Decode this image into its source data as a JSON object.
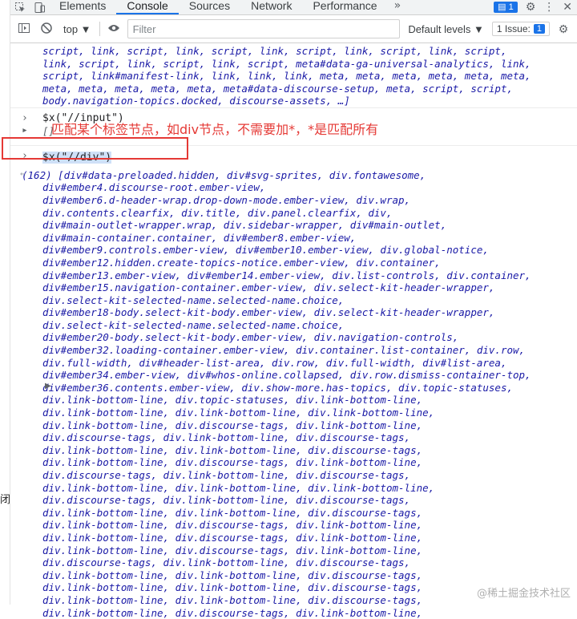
{
  "tabs": {
    "inspect_icon": "cursor-select-icon",
    "device_icon": "device-toolbar-icon",
    "items": [
      {
        "label": "Elements",
        "active": false
      },
      {
        "label": "Console",
        "active": true
      },
      {
        "label": "Sources",
        "active": false
      },
      {
        "label": "Network",
        "active": false
      },
      {
        "label": "Performance",
        "active": false
      }
    ],
    "more_label": "»",
    "issues_badge_count": "1",
    "settings_icon": "gear-icon",
    "kebab_icon": "more-vert-icon",
    "close_icon": "close-icon"
  },
  "toolbar": {
    "sidebar_icon": "sidebar-toggle-icon",
    "clear_icon": "block-icon",
    "context_value": "top ▼",
    "eye_icon": "eye-icon",
    "filter_placeholder": "Filter",
    "levels_label": "Default levels ▼",
    "issue_label": "1 Issue:",
    "issue_count": "1",
    "settings_icon": "gear-icon"
  },
  "console": {
    "top_lines": [
      "script, link, script, link, script, link, script, link, script, link, script,",
      "link, script, link, script, link, script, meta#data-ga-universal-analytics, link,",
      "script, link#manifest-link, link, link, link, meta, meta, meta, meta, meta, meta,",
      "meta, meta, meta, meta, meta, meta#data-discourse-setup, meta, script, script,",
      "body.navigation-topics.docked, discourse-assets, …]"
    ],
    "cmd1": "$x(\"//input\")",
    "result1": "[]",
    "cmd2": "$x(\"//div\")",
    "result2_lines": [
      "(162) [div#data-preloaded.hidden, div#svg-sprites, div.fontawesome,",
      "div#ember4.discourse-root.ember-view,",
      "div#ember6.d-header-wrap.drop-down-mode.ember-view, div.wrap,",
      "div.contents.clearfix, div.title, div.panel.clearfix, div,",
      "div#main-outlet-wrapper.wrap, div.sidebar-wrapper, div#main-outlet,",
      "div#main-container.container, div#ember8.ember-view,",
      "div#ember9.controls.ember-view, div#ember10.ember-view, div.global-notice,",
      "div#ember12.hidden.create-topics-notice.ember-view, div.container,",
      "div#ember13.ember-view, div#ember14.ember-view, div.list-controls, div.container,",
      "div#ember15.navigation-container.ember-view, div.select-kit-header-wrapper,",
      "div.select-kit-selected-name.selected-name.choice,",
      "div#ember18-body.select-kit-body.ember-view, div.select-kit-header-wrapper,",
      "div.select-kit-selected-name.selected-name.choice,",
      "div#ember20-body.select-kit-body.ember-view, div.navigation-controls,",
      "div#ember32.loading-container.ember-view, div.container.list-container, div.row,",
      "div.full-width, div#header-list-area, div.row, div.full-width, div#list-area,",
      "div#ember34.ember-view, div#whos-online.collapsed, div.row.dismiss-container-top,",
      "div#ember36.contents.ember-view, div.show-more.has-topics, div.topic-statuses,",
      "div.link-bottom-line, div.topic-statuses, div.link-bottom-line,",
      "div.link-bottom-line, div.link-bottom-line, div.link-bottom-line,",
      "div.link-bottom-line, div.discourse-tags, div.link-bottom-line,",
      "div.discourse-tags, div.link-bottom-line, div.discourse-tags,",
      "div.link-bottom-line, div.link-bottom-line, div.discourse-tags,",
      "div.link-bottom-line, div.discourse-tags, div.link-bottom-line,",
      "div.discourse-tags, div.link-bottom-line, div.discourse-tags,",
      "div.link-bottom-line, div.link-bottom-line, div.link-bottom-line,",
      "div.discourse-tags, div.link-bottom-line, div.discourse-tags,",
      "div.link-bottom-line, div.link-bottom-line, div.discourse-tags,",
      "div.link-bottom-line, div.discourse-tags, div.link-bottom-line,",
      "div.link-bottom-line, div.discourse-tags, div.link-bottom-line,",
      "div.link-bottom-line, div.discourse-tags, div.link-bottom-line,",
      "div.discourse-tags, div.link-bottom-line, div.discourse-tags,",
      "div.link-bottom-line, div.link-bottom-line, div.discourse-tags,",
      "div.link-bottom-line, div.link-bottom-line, div.discourse-tags,",
      "div.link-bottom-line, div.link-bottom-line, div.discourse-tags,",
      "div.link-bottom-line, div.discourse-tags, div.link-bottom-line,"
    ]
  },
  "annotation": "匹配某个标签节点，如div节点，不需要加*，*是匹配所有",
  "left_fragments": [
    "闭"
  ],
  "watermark": "@稀土掘金技术社区",
  "colors": {
    "accent": "#1a73e8",
    "annotation": "#e53935",
    "code": "#1a1aa6"
  }
}
